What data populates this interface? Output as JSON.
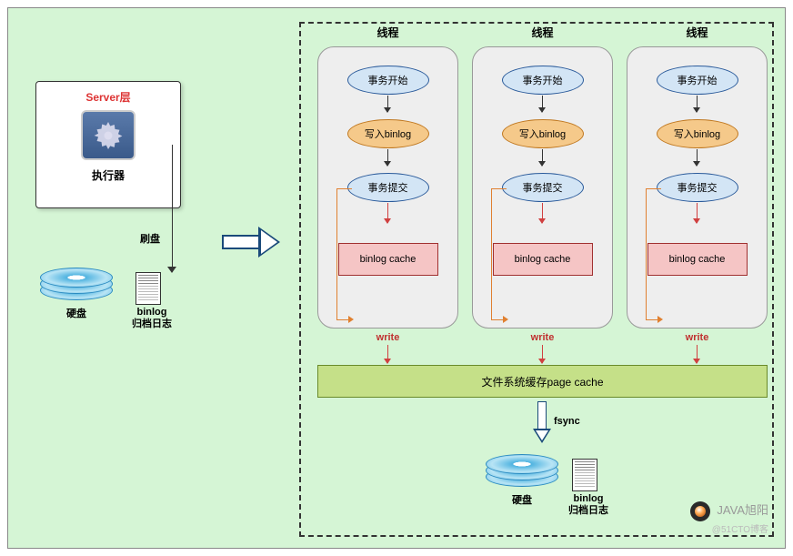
{
  "server": {
    "title": "Server层",
    "executor": "执行器"
  },
  "flush_label": "刷盘",
  "disk_label": "硬盘",
  "binlog_line1": "binlog",
  "binlog_line2": "归档日志",
  "thread_title": "线程",
  "flow": {
    "start": "事务开始",
    "write": "写入binlog",
    "commit": "事务提交",
    "cache": "binlog cache"
  },
  "write_label": "write",
  "page_cache": "文件系统缓存page cache",
  "fsync": "fsync",
  "watermark": {
    "main": "JAVA旭阳",
    "sub": "@51CTO博客"
  }
}
